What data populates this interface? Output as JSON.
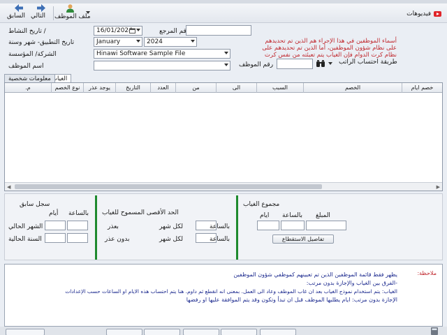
{
  "toolbar": {
    "previous_label": "السابق",
    "next_label": "التالي",
    "employee_file_label": "ملف الموظف",
    "videos_label": "فيديوهات"
  },
  "form": {
    "activity_date_label": "/ تاريخ النشاط",
    "activity_date_value": "16/01/2024",
    "reference_label": "رقم المرجع",
    "reference_value": "",
    "apply_date_label": "تاريخ التطبيق- شهر وسنة",
    "month_value": "January",
    "year_value": "2024",
    "company_label": "الشركة/ المؤسسة",
    "company_value": "Hinawi Software Sample File",
    "employee_name_label": "اسم الموظف",
    "employee_name_value": "",
    "employee_no_label": "رقم الموظف",
    "employee_no_value": "",
    "salary_calc_label": "طريقة احتساب الراتب",
    "red_note_1": "أسماء الموظفين في هذا الإجراء هم الذين تم تحديدهم",
    "red_note_2": "على نظام شؤون الموظفين، أما الذين تم تحديدهم على",
    "red_note_3": "نظام كرت الدوام فإن الغياب يتم تعبئته من نفس كرت"
  },
  "tabs": [
    {
      "label": "الغياب"
    },
    {
      "label": "معلومات شخصية"
    }
  ],
  "grid": {
    "columns": [
      "خصم ايام",
      "الخصم",
      "السبب",
      "الى",
      "من",
      "العدد",
      "التاريخ",
      "يوجد عذر",
      "نوع الخصم",
      "م."
    ]
  },
  "previous_record": {
    "title": "سجل سابق",
    "days_label": "أيام",
    "hours_label": "بالساعة",
    "current_month_label": "الشهر الحالي",
    "current_year_label": "السنة الحالية"
  },
  "max_allowed": {
    "title": "الحد الأقصى المسموح للغياب",
    "with_excuse_label": "بعذر",
    "without_excuse_label": "بدون عذر",
    "per_month_label_1": "لكل شهر",
    "per_month_label_2": "لكل شهر",
    "hours_label_1": "بالساعة",
    "hours_label_2": "بالساعة"
  },
  "absence_total": {
    "title": "مجموع الغياب",
    "amount_label": "المبلغ",
    "hours_label": "بالساعة",
    "days_label": "ايام",
    "details_button": "تفاصيل الاستقطاع"
  },
  "notes": {
    "title": "ملاحظة:",
    "line_1": "يظهر فقط قائمة الموظفين الذين تم تعيينهم كموظفي شؤون الموظفين",
    "line_2": "-الفرق بين الغياب والإجازة بدون مرتب:",
    "line_3": "الغياب: يتم استخدام نموذج الغياب بعد ان غاب الموظف وعاد الى العمل. بمعنى انه انقطع ثم داوم. هنا يتم احتساب هذه الايام او الساعات حسب الإعدادات",
    "line_4": "الإجازة بدون مرتب: ايام يطلبها الموظف قبل ان تبدأ وتكون وقد يتم الموافقة عليها او رفضها"
  },
  "colors": {
    "accent_green": "#1e8a2e",
    "note_red": "#c0272d",
    "note_blue": "#1d2b8f"
  }
}
